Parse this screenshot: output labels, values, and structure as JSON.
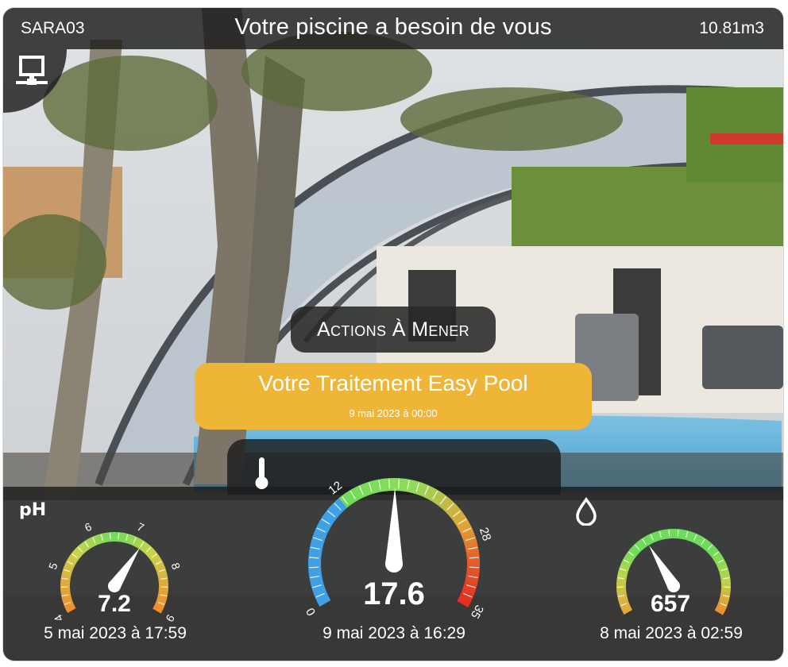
{
  "header": {
    "device": "SARA03",
    "title": "Votre piscine a besoin de vous",
    "volume": "10.81m3"
  },
  "network_icon": "network-icon",
  "actions": {
    "label": "Actions À Mener"
  },
  "treatment": {
    "title": "Votre Traitement Easy Pool",
    "date": "9 mai 2023 à 00:00"
  },
  "gauges": {
    "ph": {
      "icon": "pH",
      "value": "7.2",
      "date": "5 mai 2023 à 17:59",
      "min": 4,
      "max": 9,
      "reading": 7.2,
      "ticks": [
        "4",
        "5",
        "6",
        "7",
        "8",
        "9"
      ]
    },
    "temperature": {
      "icon": "thermometer-icon",
      "value": "17.6",
      "date": "9 mai 2023 à 16:29",
      "min": 0,
      "max": 35,
      "reading": 17.6,
      "ticks": [
        "0",
        "12",
        "28",
        "35"
      ]
    },
    "orp": {
      "icon": "water-drop-icon",
      "value": "657",
      "date": "8 mai 2023 à 02:59",
      "reading_fraction": 0.37
    }
  },
  "colors": {
    "amber": "#efb537",
    "bar": "#1c1c1c",
    "green": "#6fdb5a",
    "blue": "#3fa0e6",
    "red": "#e52b20",
    "orange": "#ee9a3a"
  }
}
